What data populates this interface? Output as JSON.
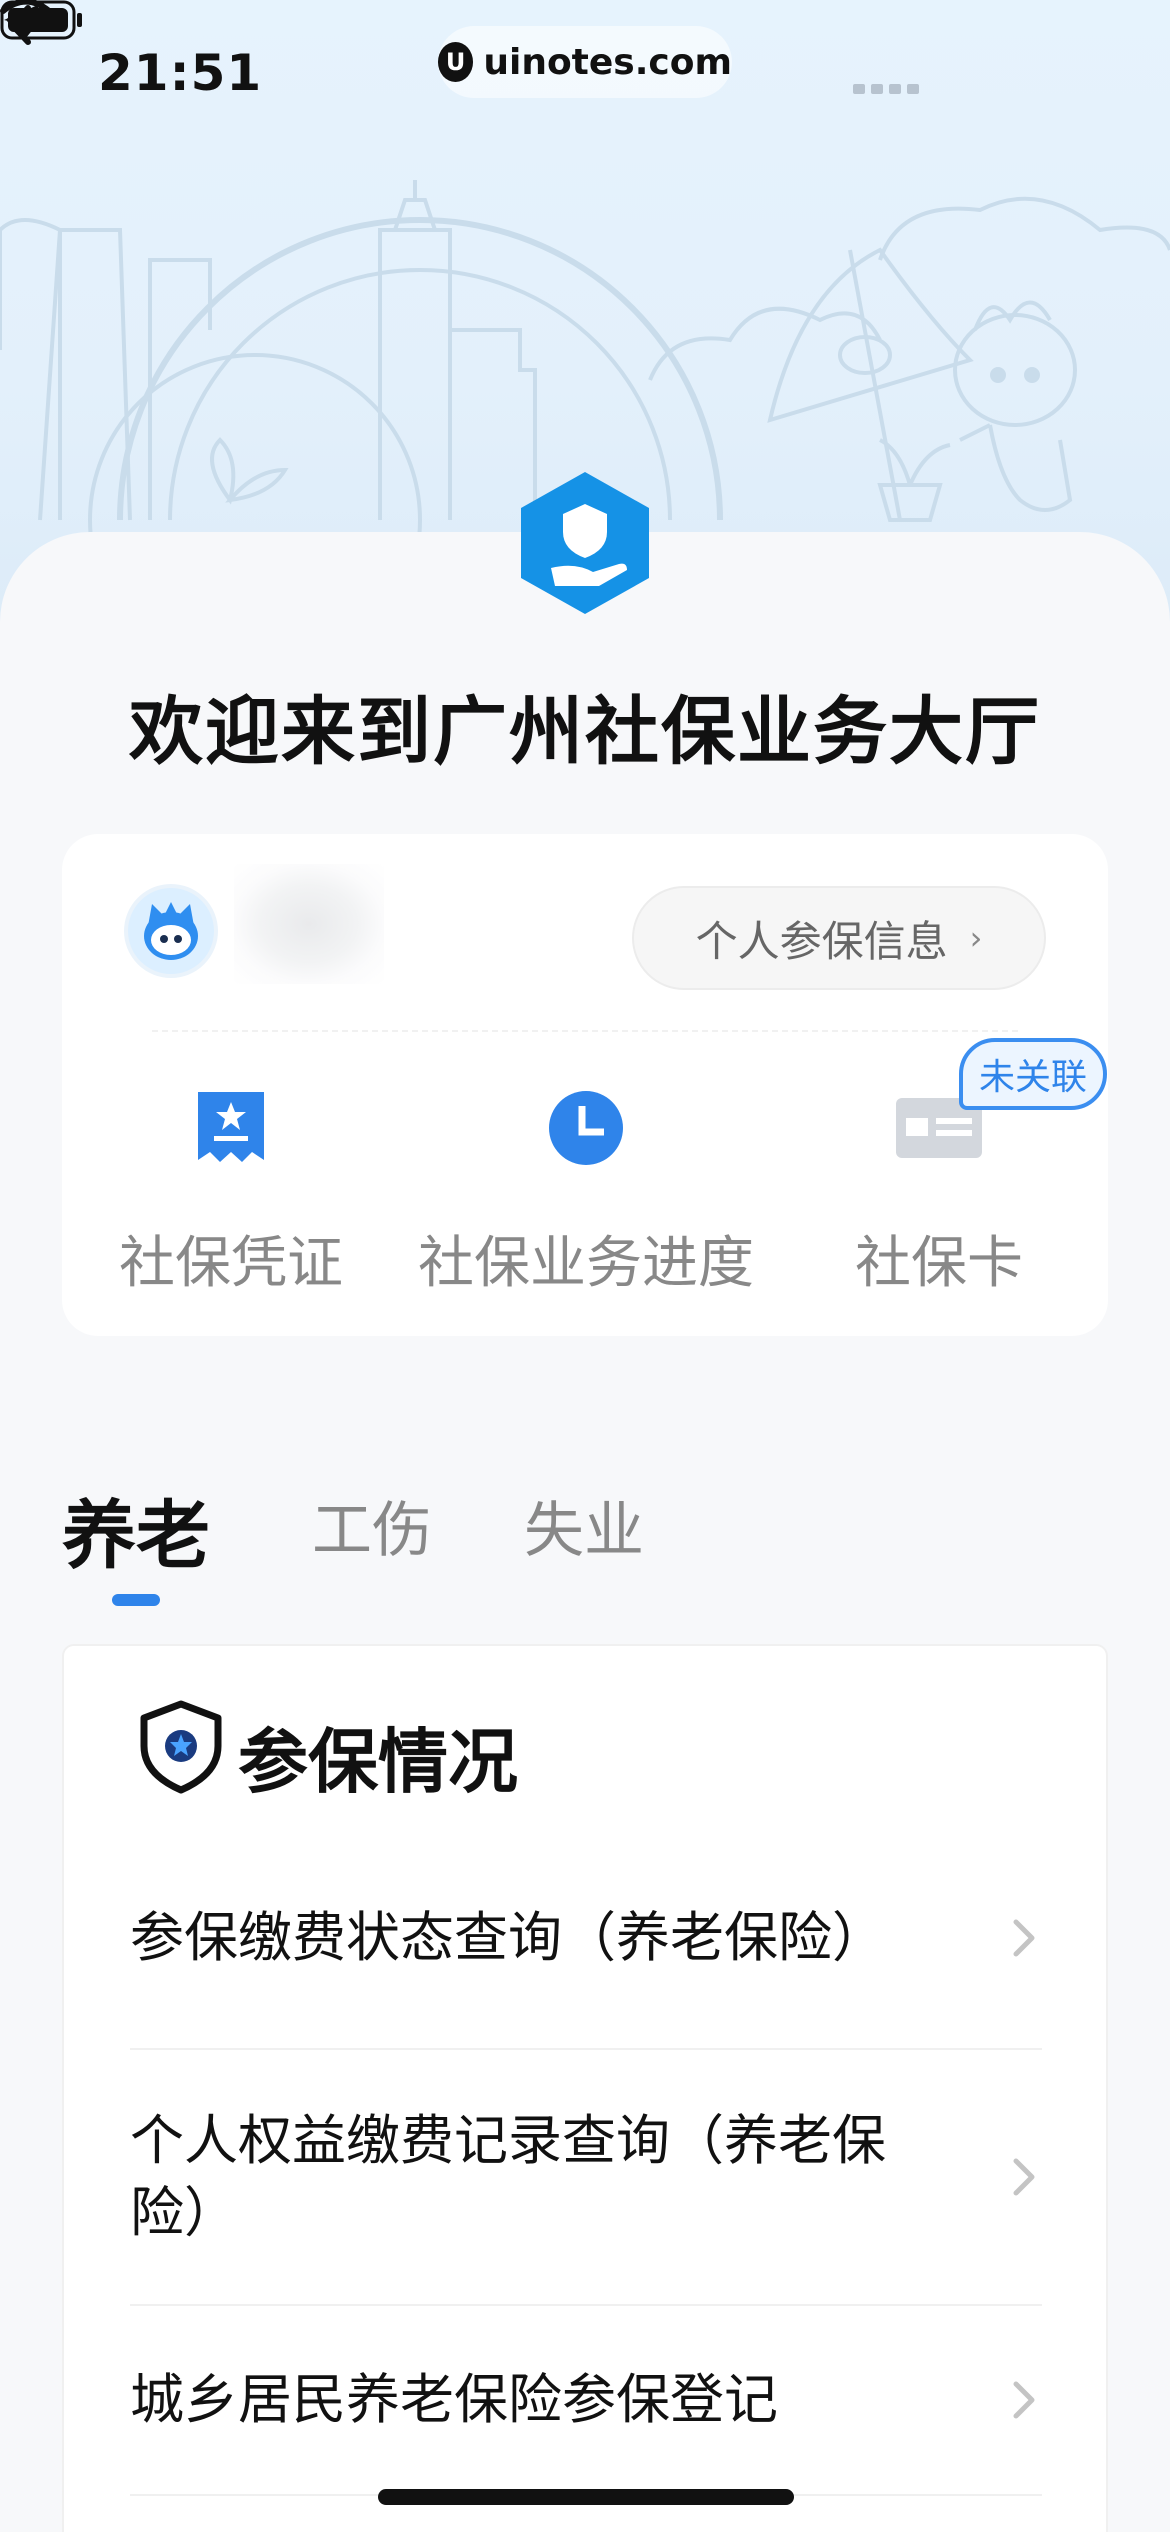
{
  "status_bar": {
    "time": "21:51",
    "url": "uinotes.com",
    "url_logo_glyph": "U"
  },
  "header": {
    "welcome_title": "欢迎来到广州社保业务大厅"
  },
  "user_card": {
    "info_button_label": "个人参保信息",
    "info_button_chevron": "›",
    "services": [
      {
        "label": "社保凭证",
        "icon": "voucher-icon"
      },
      {
        "label": "社保业务进度",
        "icon": "clock-icon"
      },
      {
        "label": "社保卡",
        "icon": "card-icon"
      }
    ],
    "unlinked_tag": "未关联"
  },
  "tabs": [
    {
      "label": "养老",
      "active": true
    },
    {
      "label": "工伤",
      "active": false
    },
    {
      "label": "失业",
      "active": false
    }
  ],
  "panel": {
    "title": "参保情况",
    "items": [
      {
        "label": "参保缴费状态查询（养老保险）"
      },
      {
        "label": "个人权益缴费记录查询（养老保险）"
      },
      {
        "label": "城乡居民养老保险参保登记"
      }
    ]
  },
  "colors": {
    "accent": "#2f84ea",
    "hero_background": "#e6f3fd",
    "page_background": "#f7f8fa"
  }
}
